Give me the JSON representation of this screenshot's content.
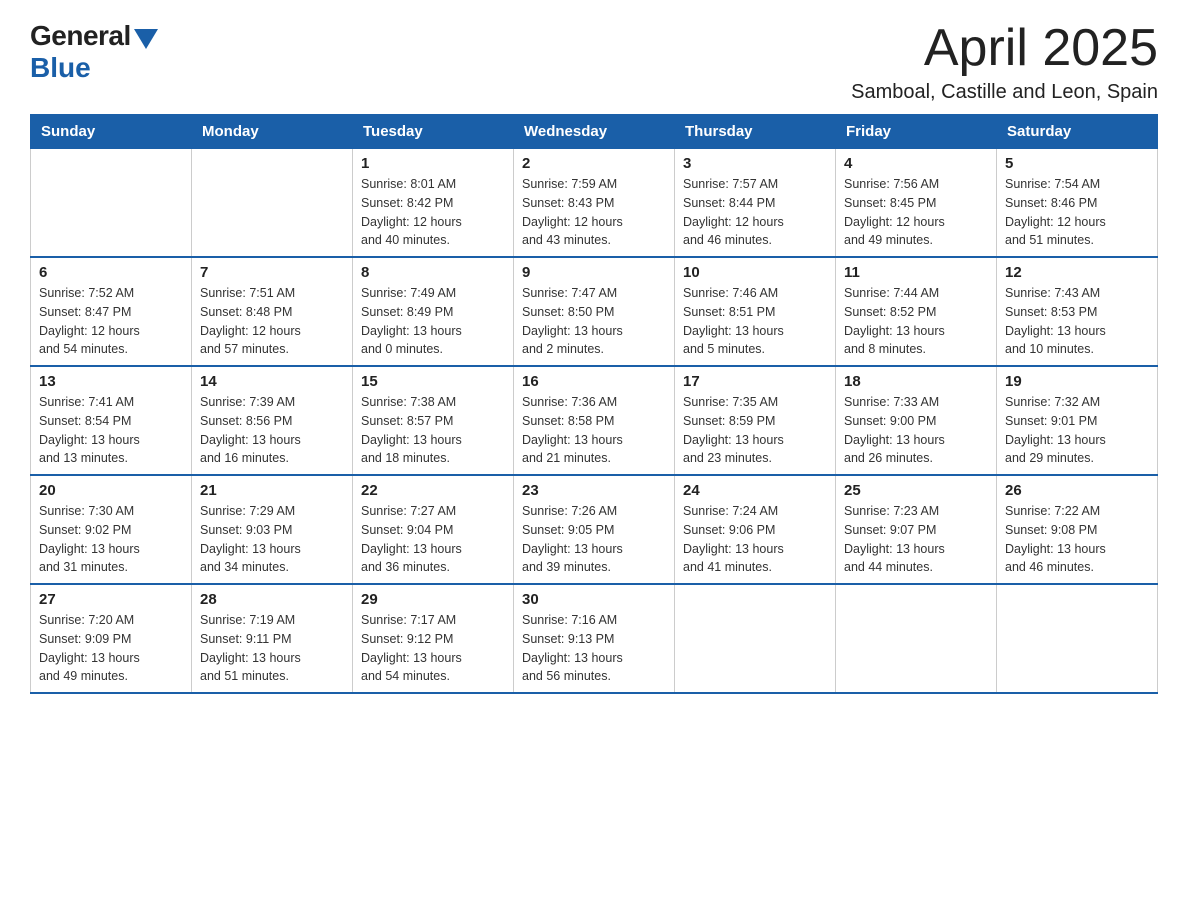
{
  "logo": {
    "general": "General",
    "blue": "Blue"
  },
  "title": "April 2025",
  "subtitle": "Samboal, Castille and Leon, Spain",
  "weekdays": [
    "Sunday",
    "Monday",
    "Tuesday",
    "Wednesday",
    "Thursday",
    "Friday",
    "Saturday"
  ],
  "weeks": [
    [
      {
        "day": "",
        "info": ""
      },
      {
        "day": "",
        "info": ""
      },
      {
        "day": "1",
        "info": "Sunrise: 8:01 AM\nSunset: 8:42 PM\nDaylight: 12 hours\nand 40 minutes."
      },
      {
        "day": "2",
        "info": "Sunrise: 7:59 AM\nSunset: 8:43 PM\nDaylight: 12 hours\nand 43 minutes."
      },
      {
        "day": "3",
        "info": "Sunrise: 7:57 AM\nSunset: 8:44 PM\nDaylight: 12 hours\nand 46 minutes."
      },
      {
        "day": "4",
        "info": "Sunrise: 7:56 AM\nSunset: 8:45 PM\nDaylight: 12 hours\nand 49 minutes."
      },
      {
        "day": "5",
        "info": "Sunrise: 7:54 AM\nSunset: 8:46 PM\nDaylight: 12 hours\nand 51 minutes."
      }
    ],
    [
      {
        "day": "6",
        "info": "Sunrise: 7:52 AM\nSunset: 8:47 PM\nDaylight: 12 hours\nand 54 minutes."
      },
      {
        "day": "7",
        "info": "Sunrise: 7:51 AM\nSunset: 8:48 PM\nDaylight: 12 hours\nand 57 minutes."
      },
      {
        "day": "8",
        "info": "Sunrise: 7:49 AM\nSunset: 8:49 PM\nDaylight: 13 hours\nand 0 minutes."
      },
      {
        "day": "9",
        "info": "Sunrise: 7:47 AM\nSunset: 8:50 PM\nDaylight: 13 hours\nand 2 minutes."
      },
      {
        "day": "10",
        "info": "Sunrise: 7:46 AM\nSunset: 8:51 PM\nDaylight: 13 hours\nand 5 minutes."
      },
      {
        "day": "11",
        "info": "Sunrise: 7:44 AM\nSunset: 8:52 PM\nDaylight: 13 hours\nand 8 minutes."
      },
      {
        "day": "12",
        "info": "Sunrise: 7:43 AM\nSunset: 8:53 PM\nDaylight: 13 hours\nand 10 minutes."
      }
    ],
    [
      {
        "day": "13",
        "info": "Sunrise: 7:41 AM\nSunset: 8:54 PM\nDaylight: 13 hours\nand 13 minutes."
      },
      {
        "day": "14",
        "info": "Sunrise: 7:39 AM\nSunset: 8:56 PM\nDaylight: 13 hours\nand 16 minutes."
      },
      {
        "day": "15",
        "info": "Sunrise: 7:38 AM\nSunset: 8:57 PM\nDaylight: 13 hours\nand 18 minutes."
      },
      {
        "day": "16",
        "info": "Sunrise: 7:36 AM\nSunset: 8:58 PM\nDaylight: 13 hours\nand 21 minutes."
      },
      {
        "day": "17",
        "info": "Sunrise: 7:35 AM\nSunset: 8:59 PM\nDaylight: 13 hours\nand 23 minutes."
      },
      {
        "day": "18",
        "info": "Sunrise: 7:33 AM\nSunset: 9:00 PM\nDaylight: 13 hours\nand 26 minutes."
      },
      {
        "day": "19",
        "info": "Sunrise: 7:32 AM\nSunset: 9:01 PM\nDaylight: 13 hours\nand 29 minutes."
      }
    ],
    [
      {
        "day": "20",
        "info": "Sunrise: 7:30 AM\nSunset: 9:02 PM\nDaylight: 13 hours\nand 31 minutes."
      },
      {
        "day": "21",
        "info": "Sunrise: 7:29 AM\nSunset: 9:03 PM\nDaylight: 13 hours\nand 34 minutes."
      },
      {
        "day": "22",
        "info": "Sunrise: 7:27 AM\nSunset: 9:04 PM\nDaylight: 13 hours\nand 36 minutes."
      },
      {
        "day": "23",
        "info": "Sunrise: 7:26 AM\nSunset: 9:05 PM\nDaylight: 13 hours\nand 39 minutes."
      },
      {
        "day": "24",
        "info": "Sunrise: 7:24 AM\nSunset: 9:06 PM\nDaylight: 13 hours\nand 41 minutes."
      },
      {
        "day": "25",
        "info": "Sunrise: 7:23 AM\nSunset: 9:07 PM\nDaylight: 13 hours\nand 44 minutes."
      },
      {
        "day": "26",
        "info": "Sunrise: 7:22 AM\nSunset: 9:08 PM\nDaylight: 13 hours\nand 46 minutes."
      }
    ],
    [
      {
        "day": "27",
        "info": "Sunrise: 7:20 AM\nSunset: 9:09 PM\nDaylight: 13 hours\nand 49 minutes."
      },
      {
        "day": "28",
        "info": "Sunrise: 7:19 AM\nSunset: 9:11 PM\nDaylight: 13 hours\nand 51 minutes."
      },
      {
        "day": "29",
        "info": "Sunrise: 7:17 AM\nSunset: 9:12 PM\nDaylight: 13 hours\nand 54 minutes."
      },
      {
        "day": "30",
        "info": "Sunrise: 7:16 AM\nSunset: 9:13 PM\nDaylight: 13 hours\nand 56 minutes."
      },
      {
        "day": "",
        "info": ""
      },
      {
        "day": "",
        "info": ""
      },
      {
        "day": "",
        "info": ""
      }
    ]
  ]
}
